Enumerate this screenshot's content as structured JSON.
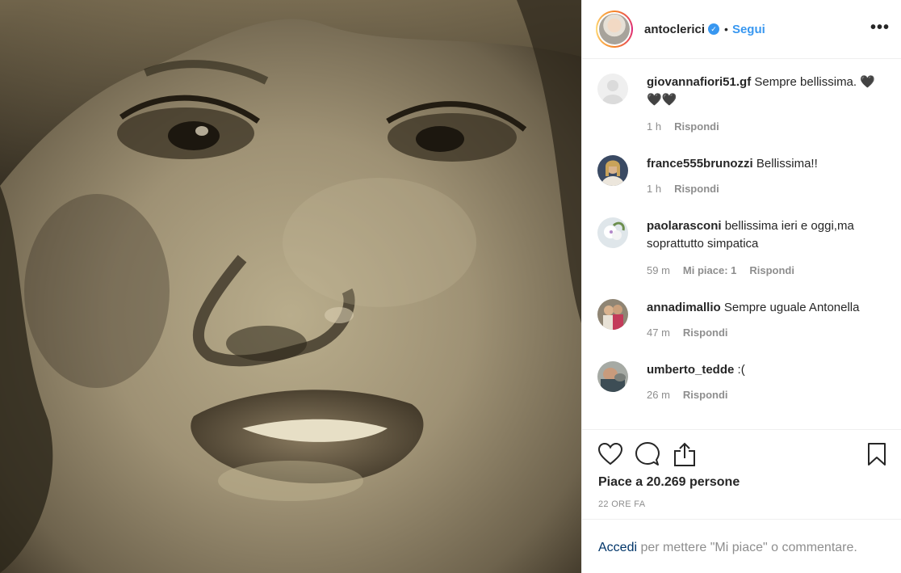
{
  "post": {
    "owner": "antoclerici",
    "dot": "•",
    "follow_label": "Segui",
    "more_label": "•••"
  },
  "comments": [
    {
      "user": "giovannafiori51.gf",
      "text": "Sempre bellissima. 🖤🖤🖤",
      "time": "1 h",
      "likes": "",
      "reply": "Rispondi"
    },
    {
      "user": "france555brunozzi",
      "text": "Bellissima!!",
      "time": "1 h",
      "likes": "",
      "reply": "Rispondi"
    },
    {
      "user": "paolarasconi",
      "text": "bellissima ieri e oggi,ma soprattutto simpatica",
      "time": "59 m",
      "likes": "Mi piace: 1",
      "reply": "Rispondi"
    },
    {
      "user": "annadimallio",
      "text": "Sempre uguale Antonella",
      "time": "47 m",
      "likes": "",
      "reply": "Rispondi"
    },
    {
      "user": "umberto_tedde",
      "text": ":(",
      "time": "26 m",
      "likes": "",
      "reply": "Rispondi"
    }
  ],
  "actions": {
    "icons": [
      "heart-icon",
      "comment-icon",
      "share-icon",
      "bookmark-icon"
    ],
    "likes_text": "Piace a 20.269 persone",
    "time_ago": "22 ORE FA"
  },
  "login": {
    "link": "Accedi",
    "rest": " per mettere \"Mi piace\" o commentare."
  },
  "colors": {
    "link_blue": "#3897f0",
    "text": "#262626",
    "muted": "#8e8e8e",
    "login_link": "#003569"
  }
}
